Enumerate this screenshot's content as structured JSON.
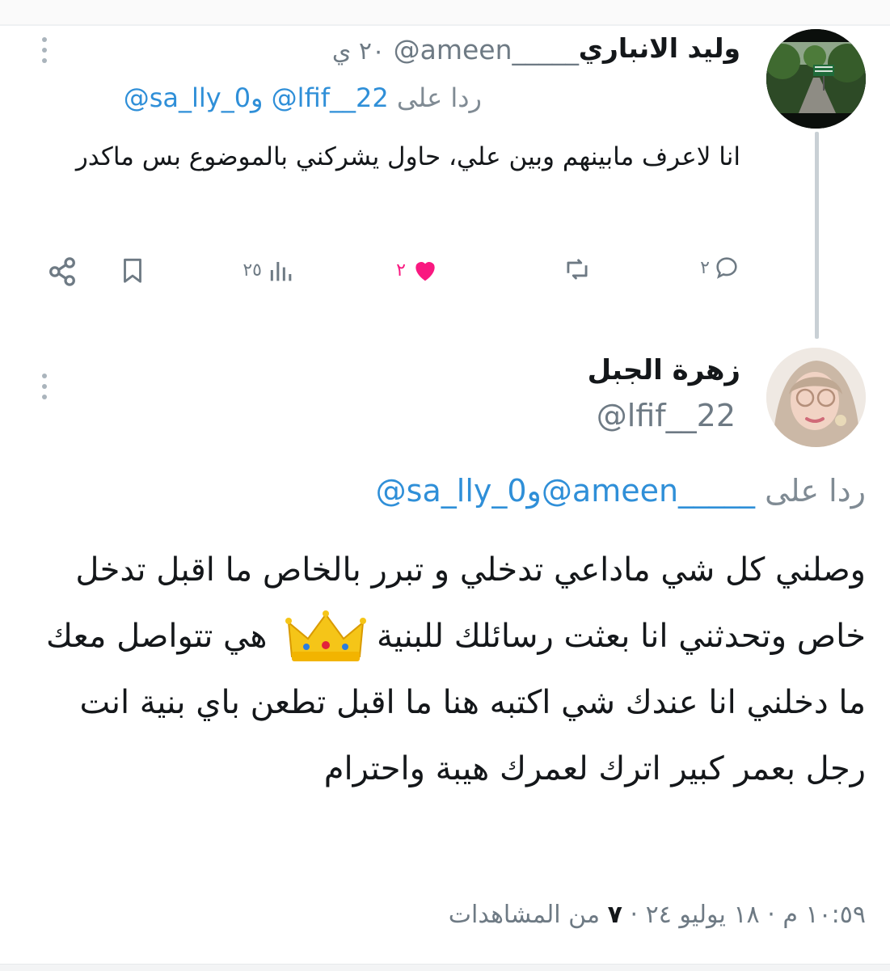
{
  "tweet1": {
    "author_name": "وليد الانباري",
    "handle": "@ameen_____",
    "time": "٢٠ ي",
    "reply_prefix": "ردا على",
    "reply_user1": "@lfif__22",
    "reply_and": "و",
    "reply_user2": "@sa_lly_0",
    "text": "انا لاعرف مابينهم وبين علي، حاول يشركني بالموضوع بس ماكدر",
    "actions": {
      "replies": "٢",
      "likes": "٢",
      "views": "٢٥"
    }
  },
  "tweet2": {
    "author_name": "زهرة الجبل",
    "handle": "@lfif__22",
    "reply_prefix": "ردا على",
    "reply_user1": "@ameen_____",
    "reply_and": "و",
    "reply_user2": "@sa_lly_0",
    "text_part1": "وصلني كل شي ماداعي تدخلي و تبرر بالخاص ما اقبل تدخل خاص وتحدثني انا بعثت رسائلك للبنية",
    "text_part2": "هي تتواصل معك ما دخلني انا عندك شي اكتبه هنا ما اقبل تطعن باي بنية انت رجل بعمر كبير اترك لعمرك هيبة واحترام",
    "time": "١٠:٥٩ م",
    "date": "١٨ يوليو ٢٤",
    "dot": "·",
    "views": "٧",
    "views_label": "من المشاهدات"
  },
  "colors": {
    "accent": "#2f8fd8",
    "like": "#f91880",
    "muted": "#6e7a84"
  },
  "icons": [
    "more-vertical-icon",
    "reply-icon",
    "retweet-icon",
    "heart-icon",
    "views-icon",
    "bookmark-icon",
    "share-icon",
    "crown-emoji"
  ]
}
